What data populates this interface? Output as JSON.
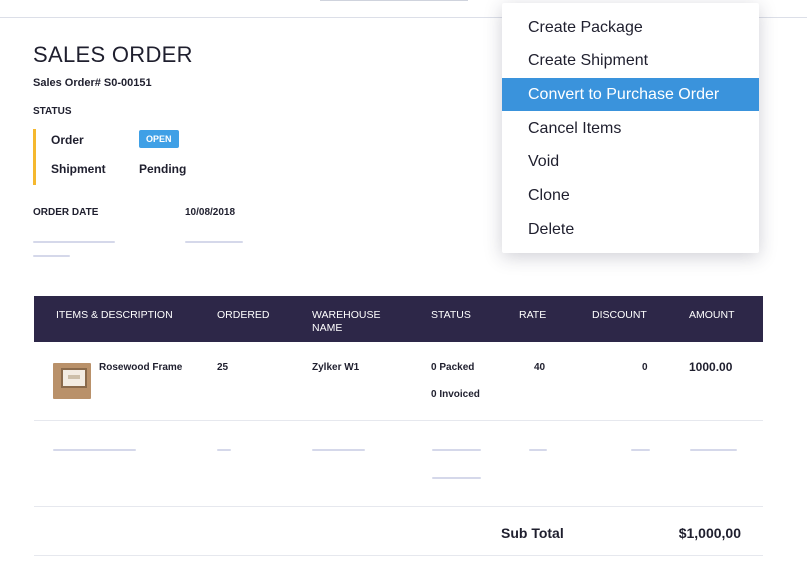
{
  "page": {
    "title": "SALES ORDER",
    "sales_order_number": "Sales Order# S0-00151",
    "status_heading": "STATUS",
    "status": {
      "order_label": "Order",
      "order_value": "OPEN",
      "shipment_label": "Shipment",
      "shipment_value": "Pending"
    },
    "order_date_label": "ORDER DATE",
    "order_date_value": "10/08/2018"
  },
  "table": {
    "headers": {
      "items": "ITEMS & DESCRIPTION",
      "ordered": "ORDERED",
      "warehouse": "WAREHOUSE NAME",
      "status": "STATUS",
      "rate": "RATE",
      "discount": "DISCOUNT",
      "amount": "AMOUNT"
    },
    "rows": [
      {
        "item": "Rosewood Frame",
        "ordered": "25",
        "warehouse": "Zylker W1",
        "status_packed": "0 Packed",
        "status_invoiced": "0 Invoiced",
        "rate": "40",
        "discount": "0",
        "amount": "1000.00"
      }
    ],
    "subtotal_label": "Sub Total",
    "subtotal_value": "$1,000,00"
  },
  "dropdown": {
    "items": [
      {
        "label": "Create Package"
      },
      {
        "label": "Create Shipment"
      },
      {
        "label": "Convert to Purchase Order"
      },
      {
        "label": "Cancel Items"
      },
      {
        "label": "Void"
      },
      {
        "label": "Clone"
      },
      {
        "label": "Delete"
      }
    ],
    "active_index": 2
  },
  "colors": {
    "accent_status_bar": "#f5b82e",
    "badge_open": "#3fa0e6",
    "table_header": "#2d2748",
    "menu_highlight": "#3a93dc"
  },
  "icons": {
    "item_thumbnail": "picture-frame-image"
  }
}
